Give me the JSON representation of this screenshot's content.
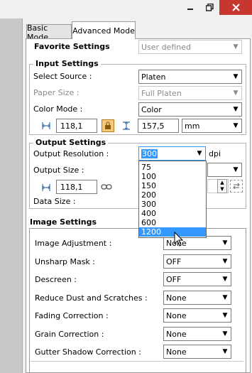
{
  "window": {
    "minimize_icon": "minimize-icon",
    "restore_icon": "restore-icon",
    "close_icon": "close-icon",
    "close_color": "#c7372f"
  },
  "tabs": [
    {
      "label": "Basic Mode"
    },
    {
      "label": "Advanced Mode"
    }
  ],
  "favorite": {
    "label": "Favorite Settings",
    "value": "User defined"
  },
  "input_settings": {
    "title": "Input Settings",
    "select_source": {
      "label": "Select Source :",
      "value": "Platen"
    },
    "paper_size": {
      "label": "Paper Size :",
      "value": "Full Platen"
    },
    "color_mode": {
      "label": "Color Mode :",
      "value": "Color"
    },
    "width": "118,1",
    "height": "157,5",
    "unit": "mm"
  },
  "output_settings": {
    "title": "Output Settings",
    "resolution": {
      "label": "Output Resolution :",
      "value": "300",
      "unit": "dpi"
    },
    "output_size": {
      "label": "Output Size :"
    },
    "width": "118,1",
    "data_size": {
      "label": "Data Size :"
    }
  },
  "resolution_options": [
    "75",
    "100",
    "150",
    "200",
    "300",
    "400",
    "600",
    "1200"
  ],
  "resolution_highlighted": "1200",
  "image_settings": {
    "title": "Image Settings",
    "rows": [
      {
        "label": "Image Adjustment :",
        "value": "None"
      },
      {
        "label": "Unsharp Mask :",
        "value": "OFF"
      },
      {
        "label": "Descreen :",
        "value": "OFF"
      },
      {
        "label": "Reduce Dust and Scratches :",
        "value": "None"
      },
      {
        "label": "Fading Correction :",
        "value": "None"
      },
      {
        "label": "Grain Correction :",
        "value": "None"
      },
      {
        "label": "Gutter Shadow Correction :",
        "value": "None"
      }
    ]
  },
  "colors": {
    "highlight": "#3399ff",
    "accent_lock": "#e8a33c"
  }
}
